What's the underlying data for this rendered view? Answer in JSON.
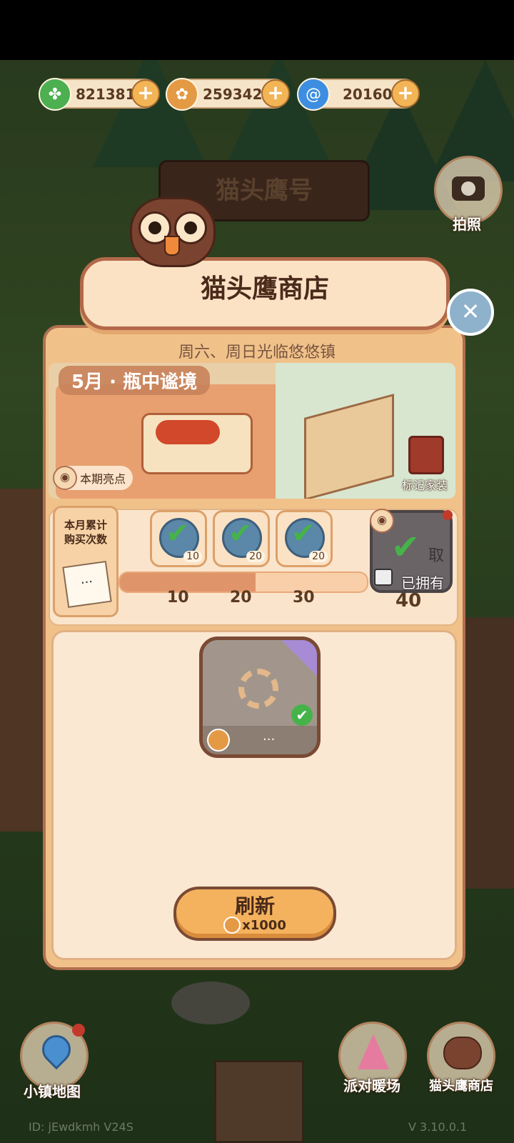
{
  "currencies": [
    {
      "name": "clover",
      "value": "821381",
      "color": "#4caf50",
      "icon": "clover-icon"
    },
    {
      "name": "coin",
      "value": "259342",
      "color": "#e49a45",
      "icon": "coin-icon"
    },
    {
      "name": "swirl",
      "value": "20160",
      "color": "#3d8ee0",
      "icon": "swirl-icon"
    }
  ],
  "plus_glyph": "+",
  "background_sign": "猫头鹰号",
  "side_buttons": {
    "photo": "拍照",
    "town_map": "小镇地图",
    "party": "派对暖场",
    "owl_shop": "猫头鹰商店"
  },
  "shop": {
    "title": "猫头鹰商店",
    "subtitle": "周六、周日光临悠悠镇",
    "close_glyph": "✕",
    "theme": "5月 · 瓶中谧境",
    "highlights_label": "本期亮点",
    "mark_decor_label": "标记家装",
    "monthly": {
      "label": "本月累计购买次数",
      "note_dots": "...",
      "progress": 0.55,
      "milestones": [
        {
          "threshold": "10",
          "count": "10",
          "claimed": true
        },
        {
          "threshold": "20",
          "count": "20",
          "claimed": true
        },
        {
          "threshold": "30",
          "count": "20",
          "claimed": true
        },
        {
          "threshold": "40",
          "status": "已拥有",
          "claimed": true,
          "locked": true,
          "partial_text": "取"
        }
      ]
    },
    "item": {
      "dots": "...",
      "owned": true,
      "loading": true
    },
    "refresh": {
      "label": "刷新",
      "cost": "x1000"
    }
  },
  "footer": {
    "id_text": "ID: jEwdkmh V24S",
    "version": "V 3.10.0.1"
  },
  "colors": {
    "accent": "#f3b455",
    "panel": "#f0c28a",
    "border": "#b07050",
    "text": "#5a3a22",
    "check": "#45b34a"
  }
}
